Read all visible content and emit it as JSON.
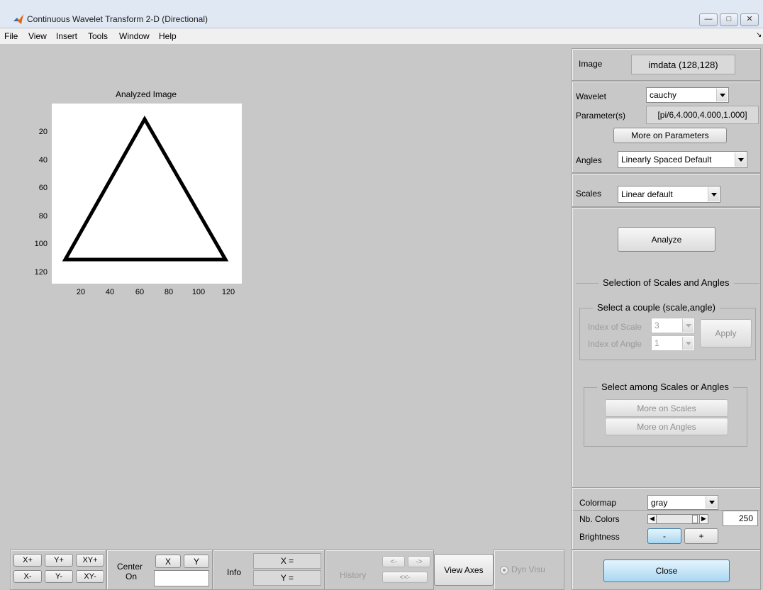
{
  "window": {
    "title": "Continuous Wavelet Transform 2-D (Directional)",
    "app_icon": "matlab-icon",
    "controls": [
      "minimize-icon",
      "maximize-icon",
      "close-icon"
    ]
  },
  "menu": [
    "File",
    "View",
    "Insert",
    "Tools",
    "Window",
    "Help"
  ],
  "plot": {
    "title": "Analyzed Image",
    "y_ticks": [
      "20",
      "40",
      "60",
      "80",
      "100",
      "120"
    ],
    "x_ticks": [
      "20",
      "40",
      "60",
      "80",
      "100",
      "120"
    ]
  },
  "right_panel": {
    "image_label": "Image",
    "image_value": "imdata  (128,128)",
    "wavelet_label": "Wavelet",
    "wavelet_value": "cauchy",
    "parameters_label": "Parameter(s)",
    "parameters_value": "[pi/6,4.000,4.000,1.000]",
    "more_params": "More on Parameters",
    "angles_label": "Angles",
    "angles_value": "Linearly Spaced Default",
    "scales_label": "Scales",
    "scales_value": "Linear default",
    "analyze": "Analyze",
    "selection_title": "Selection of Scales and Angles",
    "couple_title": "Select a couple (scale,angle)",
    "index_scale_label": "Index of Scale",
    "index_scale_value": "3",
    "index_angle_label": "Index of Angle",
    "index_angle_value": "1",
    "apply": "Apply",
    "among_title": "Select among Scales or Angles",
    "more_scales": "More on Scales",
    "more_angles": "More on Angles",
    "colormap_label": "Colormap",
    "colormap_value": "gray",
    "nb_colors_label": "Nb. Colors",
    "nb_colors_value": "250",
    "nb_colors_fraction": 0.98,
    "brightness_label": "Brightness",
    "brightness_minus": "-",
    "brightness_plus": "+",
    "close": "Close"
  },
  "bottom_bar": {
    "xplus": "X+",
    "yplus": "Y+",
    "xyplus": "XY+",
    "xminus": "X-",
    "yminus": "Y-",
    "xyminus": "XY-",
    "center_label": "Center",
    "on_label": "On",
    "center_x": "X",
    "center_y": "Y",
    "info_label": "Info",
    "x_readout": "X =",
    "y_readout": "Y =",
    "history_label": "History",
    "hist_back": "<-",
    "hist_fwd": "->",
    "hist_first": "<<-",
    "view_axes": "View Axes",
    "dyn_visu": "Dyn Visu"
  },
  "colors": {
    "figure_bg": "#c8c8c8",
    "accent_blue": "#a9d7f1"
  }
}
